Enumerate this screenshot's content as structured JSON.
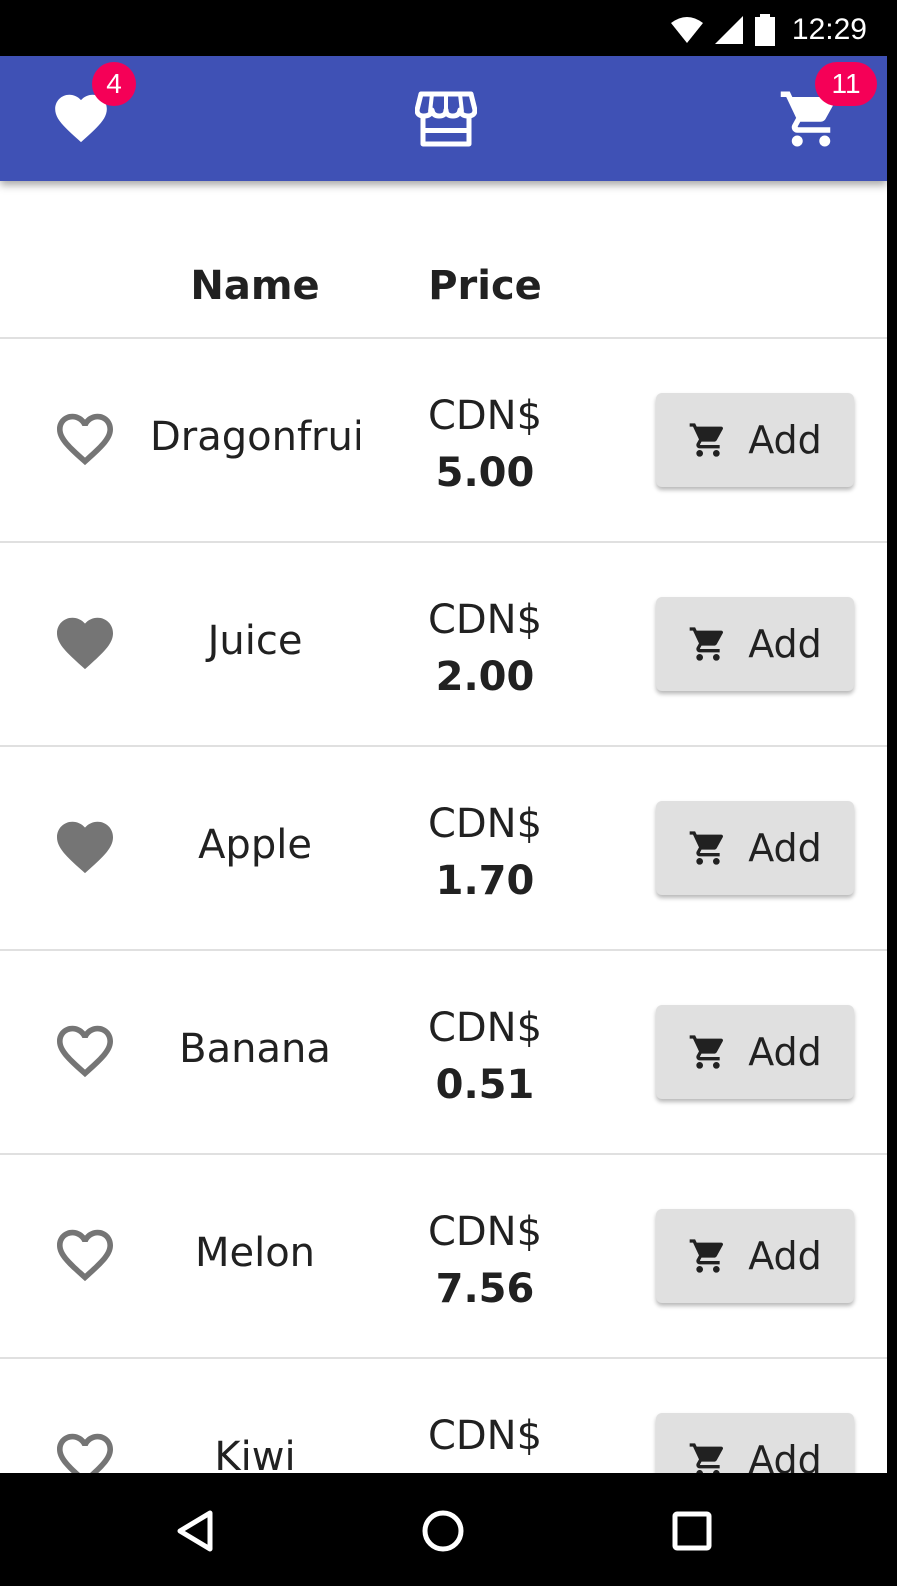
{
  "status_bar": {
    "time": "12:29",
    "icons": [
      "wifi-icon",
      "signal-icon",
      "battery-icon"
    ]
  },
  "app_bar": {
    "color": "#3f51b5",
    "favorites_count": "4",
    "cart_count": "11",
    "icons": [
      "heart-icon",
      "store-icon",
      "cart-icon"
    ],
    "badge_color": "#f50057"
  },
  "table": {
    "headers": {
      "name": "Name",
      "price": "Price"
    },
    "rows": [
      {
        "name": "Dragonfrui",
        "currency": "CDN$",
        "price": "5.00",
        "favorite": false,
        "add_label": "Add"
      },
      {
        "name": "Juice",
        "currency": "CDN$",
        "price": "2.00",
        "favorite": true,
        "add_label": "Add"
      },
      {
        "name": "Apple",
        "currency": "CDN$",
        "price": "1.70",
        "favorite": true,
        "add_label": "Add"
      },
      {
        "name": "Banana",
        "currency": "CDN$",
        "price": "0.51",
        "favorite": false,
        "add_label": "Add"
      },
      {
        "name": "Melon",
        "currency": "CDN$",
        "price": "7.56",
        "favorite": false,
        "add_label": "Add"
      },
      {
        "name": "Kiwi",
        "currency": "CDN$",
        "price": "",
        "favorite": false,
        "add_label": "Add"
      }
    ]
  },
  "nav_bar": {
    "icons": [
      "back-icon",
      "home-icon",
      "recents-icon"
    ]
  }
}
